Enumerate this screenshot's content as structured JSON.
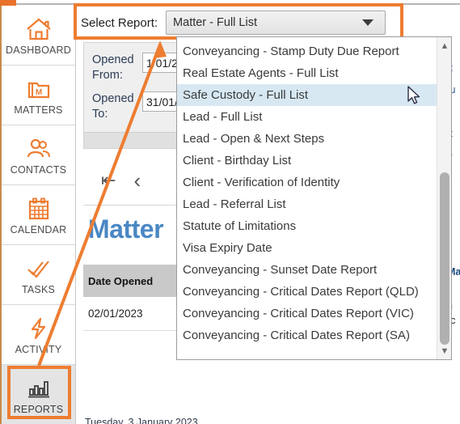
{
  "sidebar": {
    "items": [
      {
        "label": "DASHBOARD",
        "icon": "home-icon",
        "active": false
      },
      {
        "label": "MATTERS",
        "icon": "folder-matter-icon",
        "active": false
      },
      {
        "label": "CONTACTS",
        "icon": "contacts-people-icon",
        "active": false
      },
      {
        "label": "CALENDAR",
        "icon": "calendar-icon",
        "active": false
      },
      {
        "label": "TASKS",
        "icon": "tasks-check-icon",
        "active": false
      },
      {
        "label": "ACTIVITY",
        "icon": "activity-bolt-icon",
        "active": false
      },
      {
        "label": "REPORTS",
        "icon": "reports-bar-chart-icon",
        "active": true
      }
    ]
  },
  "select_report": {
    "label": "Select Report:",
    "selected_value": "Matter - Full List",
    "caret_icon": "chevron-down-icon",
    "highlight_color": "#ED7D31"
  },
  "dropdown": {
    "highlighted_item": "Safe Custody - Full List",
    "scrollbar": {
      "up_icon": "chevron-up-icon",
      "down_icon": "chevron-down-icon"
    },
    "items": [
      "Conveyancing - Stamp Duty Due Report",
      "Real Estate Agents - Full List",
      "Safe Custody - Full List",
      "Lead - Full List",
      "Lead - Open & Next Steps",
      "Client - Birthday List",
      "Client - Verification of Identity",
      "Lead - Referral List",
      "Statute of Limitations",
      "Visa Expiry Date",
      "Conveyancing - Sunset Date Report",
      "Conveyancing - Critical Dates Report (QLD)",
      "Conveyancing - Critical Dates Report (VIC)",
      "Conveyancing - Critical Dates Report (SA)"
    ]
  },
  "filters": {
    "opened_from": {
      "label": "Opened From:",
      "value": "1/01/2"
    },
    "opened_to": {
      "label": "Opened To:",
      "value": "31/01/"
    }
  },
  "viewer": {
    "first_page_icon": "first-page-icon",
    "prev_page_icon": "previous-page-icon",
    "report_title": "Matter",
    "table": {
      "headers": [
        "Date Opened"
      ],
      "rows": [
        [
          "02/01/2023"
        ]
      ]
    },
    "right_edge_fragments": [
      "tt",
      "tu",
      "tt",
      "e",
      "Ma",
      "h",
      "rc"
    ]
  },
  "status_bar": {
    "date": "Tuesday, 3 January 2023"
  },
  "colors": {
    "accent_orange": "#ED7D31",
    "title_blue": "#4A87C4",
    "selection_blue": "#D7E8F2",
    "header_grey": "#C9C9C9"
  }
}
